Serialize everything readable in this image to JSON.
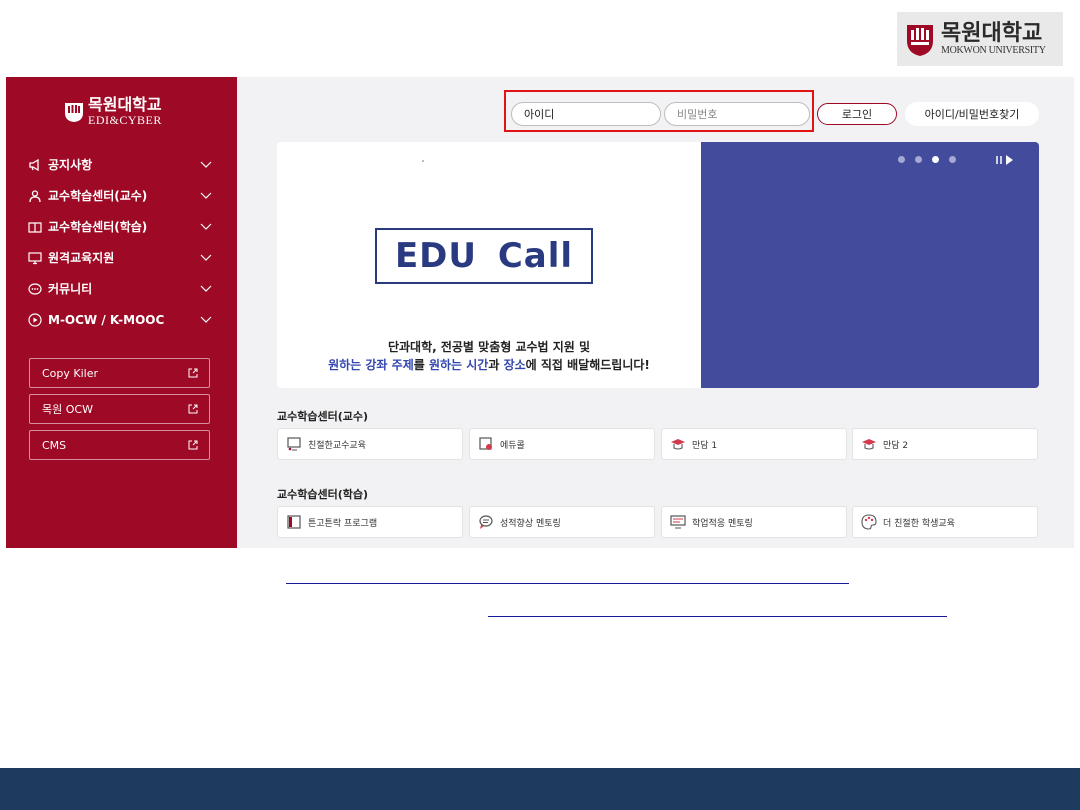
{
  "top_logo": {
    "korean": "목원대학교",
    "english": "MOKWON UNIVERSITY"
  },
  "sidebar": {
    "logo_korean": "목원대학교",
    "logo_english": "EDI&CYBER",
    "menu": [
      {
        "label": "공지사항",
        "icon": "megaphone-icon"
      },
      {
        "label": "교수학습센터(교수)",
        "icon": "person-icon"
      },
      {
        "label": "교수학습센터(학습)",
        "icon": "book-icon"
      },
      {
        "label": "원격교육지원",
        "icon": "monitor-icon"
      },
      {
        "label": "커뮤니티",
        "icon": "chat-icon"
      },
      {
        "label": "M-OCW / K-MOOC",
        "icon": "play-circle-icon"
      }
    ],
    "links": [
      {
        "label": "Copy Kiler"
      },
      {
        "label": "목원 OCW"
      },
      {
        "label": "CMS"
      }
    ]
  },
  "login": {
    "id_value": "아이디",
    "pw_placeholder": "비밀번호",
    "login_label": "로그인",
    "find_label": "아이디/비밀번호찾기"
  },
  "banner": {
    "headline": "EDU Call",
    "caption_line1": "단과대학, 전공별 맞춤형 교수법 지원 및",
    "caption_line2": {
      "p1": "원하는 강좌 주제",
      "p2": "를 ",
      "p3": "원하는 시간",
      "p4": "과 ",
      "p5": "장소",
      "p6": "에 직접 배달해드립니다!"
    },
    "active_slide": 3,
    "slide_count": 4
  },
  "section_prof": {
    "title": "교수학습센터(교수)",
    "cards": [
      {
        "label": "친절한교수교육"
      },
      {
        "label": "에듀콜"
      },
      {
        "label": "만담 1"
      },
      {
        "label": "만담 2"
      }
    ]
  },
  "section_learn": {
    "title": "교수학습센터(학습)",
    "cards": [
      {
        "label": "튼고튼락 프로그램"
      },
      {
        "label": "성적향상 멘토링"
      },
      {
        "label": "학업적응 멘토링"
      },
      {
        "label": "더 친절한 학생교육"
      }
    ]
  },
  "colors": {
    "sidebar": "#9e0a26",
    "banner_right": "#434b9c",
    "footer": "#1e3a5e",
    "highlight": "#e01414"
  }
}
